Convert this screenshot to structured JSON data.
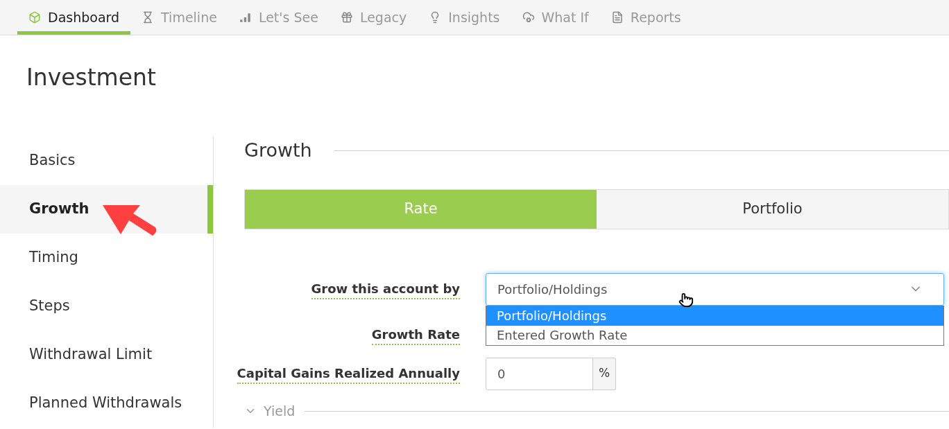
{
  "nav_tabs": [
    {
      "label": "Dashboard",
      "kind": "box",
      "selected": true
    },
    {
      "label": "Timeline",
      "kind": "hourglass",
      "selected": false
    },
    {
      "label": "Let's See",
      "kind": "bars",
      "selected": false
    },
    {
      "label": "Legacy",
      "kind": "gift",
      "selected": false
    },
    {
      "label": "Insights",
      "kind": "bulb",
      "selected": false
    },
    {
      "label": "What If",
      "kind": "cloud",
      "selected": false
    },
    {
      "label": "Reports",
      "kind": "file",
      "selected": false
    }
  ],
  "page_title": "Investment",
  "sidebar": {
    "items": [
      {
        "label": "Basics",
        "selected": false
      },
      {
        "label": "Growth",
        "selected": true
      },
      {
        "label": "Timing",
        "selected": false
      },
      {
        "label": "Steps",
        "selected": false
      },
      {
        "label": "Withdrawal Limit",
        "selected": false
      },
      {
        "label": "Planned Withdrawals",
        "selected": false
      }
    ]
  },
  "section_title": "Growth",
  "segments": [
    {
      "label": "Rate",
      "selected": true
    },
    {
      "label": "Portfolio",
      "selected": false
    }
  ],
  "form": {
    "grow_by": {
      "label": "Grow this account by",
      "value": "Portfolio/Holdings",
      "options": [
        {
          "label": "Portfolio/Holdings",
          "selected": true
        },
        {
          "label": "Entered Growth Rate",
          "selected": false
        }
      ]
    },
    "growth_rate": {
      "label": "Growth Rate"
    },
    "capital_gains": {
      "label": "Capital Gains Realized Annually",
      "value": "0",
      "unit": "%"
    }
  },
  "yield_section": {
    "label": "Yield"
  }
}
